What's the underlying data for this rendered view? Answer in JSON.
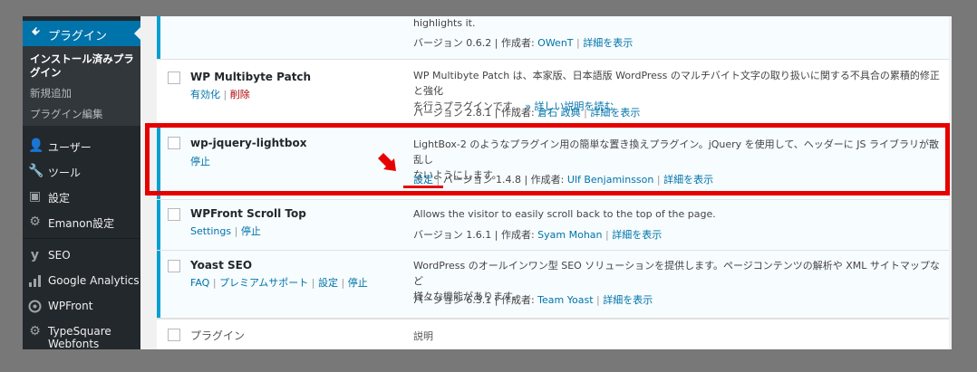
{
  "sidebar": {
    "active_menu": "プラグイン",
    "submenu": {
      "installed": "インストール済みプラグイン",
      "installed_line1": "インストール済みプラ",
      "installed_line2": "グイン",
      "add_new": "新規追加",
      "editor": "プラグイン編集"
    },
    "items": [
      {
        "label": "ユーザー",
        "icon": "users-icon"
      },
      {
        "label": "ツール",
        "icon": "wrench-icon"
      },
      {
        "label": "設定",
        "icon": "settings-icon"
      },
      {
        "label": "Emanon設定",
        "icon": "gear-icon"
      },
      {
        "label": "SEO",
        "icon": "yoast-icon"
      },
      {
        "label": "Google Analytics",
        "icon": "bar-chart-icon"
      },
      {
        "label": "WPFront",
        "icon": "wpfront-icon"
      },
      {
        "label": "TypeSquare Webfonts",
        "label_line1": "TypeSquare",
        "label_line2": "Webfonts",
        "icon": "gear-icon"
      }
    ]
  },
  "plugins": {
    "row0": {
      "desc_tail": "highlights it.",
      "version": "バージョン 0.6.2 | 作成者:",
      "author": "OWenT",
      "details": "詳細を表示"
    },
    "row1": {
      "name": "WP Multibyte Patch",
      "activate": "有効化",
      "delete": "削除",
      "desc_line1": "WP Multibyte Patch は、本家版、日本語版 WordPress のマルチバイト文字の取り扱いに関する不具合の累積的修正と強化",
      "desc_line2": "を行うプラグインです。",
      "more": "» 詳しい説明を読む",
      "version": "バージョン 2.8.1 | 作成者:",
      "author": "倉石 政典",
      "details": "詳細を表示"
    },
    "row2": {
      "name": "wp-jquery-lightbox",
      "deactivate": "停止",
      "desc_line1": "LightBox-2 のようなプラグイン用の簡単な置き換えプラグイン。jQuery を使用して、ヘッダーに JS ライブラリが散乱し",
      "desc_line2": "ないようにします。",
      "settings": "設定",
      "version": "バージョン 1.4.8 | 作成者:",
      "author": "Ulf Benjaminsson",
      "details": "詳細を表示"
    },
    "row3": {
      "name": "WPFront Scroll Top",
      "settings": "Settings",
      "deactivate": "停止",
      "desc": "Allows the visitor to easily scroll back to the top of the page.",
      "version": "バージョン 1.6.1 | 作成者:",
      "author": "Syam Mohan",
      "details": "詳細を表示"
    },
    "row4": {
      "name": "Yoast SEO",
      "faq": "FAQ",
      "premium": "プレミアムサポート",
      "settings": "設定",
      "deactivate": "停止",
      "desc_line1": "WordPress のオールインワン型 SEO ソリューションを提供します。ページコンテンツの解析や XML サイトマップなど",
      "desc_line2": "様々な機能があります。",
      "version": "バージョン 6.3.1 | 作成者:",
      "author": "Team Yoast",
      "details": "詳細を表示"
    },
    "footer": {
      "col_plugin": "プラグイン",
      "col_desc": "説明"
    }
  },
  "colors": {
    "accent": "#0073aa",
    "highlight": "#e60000",
    "active_bar": "#00a0d2",
    "sidebar_bg": "#23282d"
  }
}
